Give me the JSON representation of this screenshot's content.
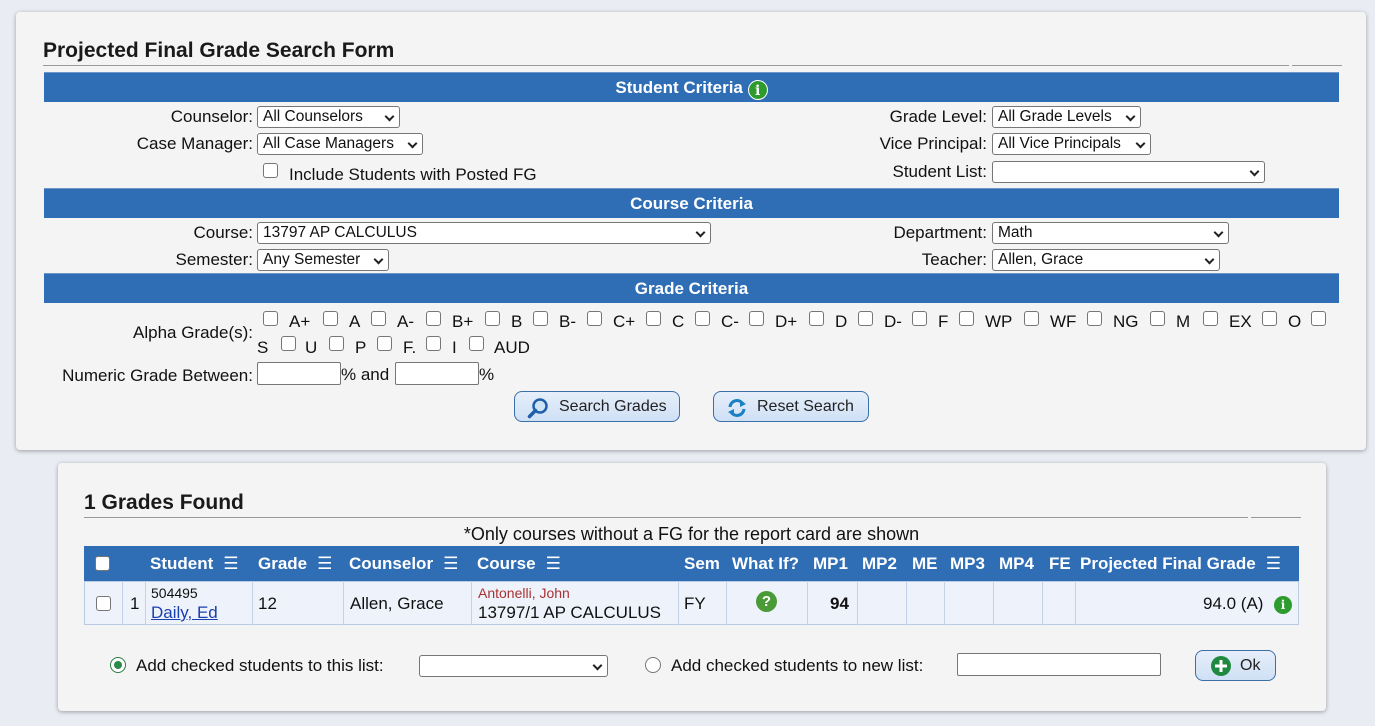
{
  "search_form": {
    "title": "Projected Final Grade Search Form",
    "student_criteria": {
      "header": "Student Criteria",
      "counselor_label": "Counselor:",
      "counselor_value": "All Counselors",
      "case_manager_label": "Case Manager:",
      "case_manager_value": "All Case Managers",
      "include_posted_label": "Include Students with Posted FG",
      "grade_level_label": "Grade Level:",
      "grade_level_value": "All Grade Levels",
      "vice_principal_label": "Vice Principal:",
      "vice_principal_value": "All Vice Principals",
      "student_list_label": "Student List:",
      "student_list_value": ""
    },
    "course_criteria": {
      "header": "Course Criteria",
      "course_label": "Course:",
      "course_value": "13797 AP CALCULUS",
      "semester_label": "Semester:",
      "semester_value": "Any Semester",
      "department_label": "Department:",
      "department_value": "Math",
      "teacher_label": "Teacher:",
      "teacher_value": "Allen, Grace"
    },
    "grade_criteria": {
      "header": "Grade Criteria",
      "alpha_label": "Alpha Grade(s):",
      "alpha_grades": [
        "A+",
        "A",
        "A-",
        "B+",
        "B",
        "B-",
        "C+",
        "C",
        "C-",
        "D+",
        "D",
        "D-",
        "F",
        "WP",
        "WF",
        "NG",
        "M",
        "EX",
        "O",
        "S",
        "U",
        "P",
        "F.",
        "I",
        "AUD"
      ],
      "numeric_label": "Numeric Grade Between:",
      "percent1": "%",
      "and_label": "% and",
      "percent2": "%"
    },
    "buttons": {
      "search": "Search Grades",
      "reset": "Reset Search"
    }
  },
  "results": {
    "title": "1 Grades Found",
    "note": "*Only courses without a FG for the report card are shown",
    "columns": [
      "Student",
      "Grade",
      "Counselor",
      "Course",
      "Sem",
      "What If?",
      "MP1",
      "MP2",
      "ME",
      "MP3",
      "MP4",
      "FE",
      "Projected Final Grade"
    ],
    "menu_glyph": "☰",
    "rows": [
      {
        "index": "1",
        "student_id": "504495",
        "student_name": "Daily, Ed",
        "grade": "12",
        "counselor": "Allen, Grace",
        "teacher": "Antonelli, John",
        "course": "13797/1 AP CALCULUS",
        "sem": "FY",
        "what_if": "?",
        "mp1": "94",
        "mp2": "",
        "me": "",
        "mp3": "",
        "mp4": "",
        "fe": "",
        "projected": "94.0 (A)"
      }
    ],
    "add_existing_label": "Add checked students to this list:",
    "add_existing_value": "",
    "add_new_label": "Add checked students to new list:",
    "add_new_value": "",
    "ok_label": "Ok"
  },
  "colors": {
    "header_blue": "#2f6db5",
    "info_green": "#2e9b2e",
    "teacher_red": "#a83232"
  }
}
